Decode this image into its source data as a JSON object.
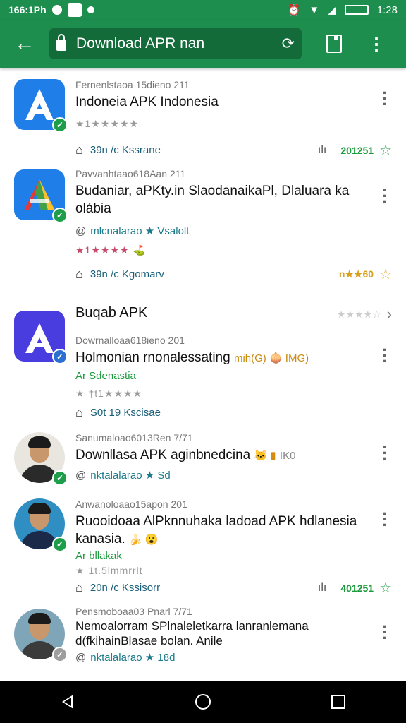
{
  "status_bar": {
    "time_left": "166:1Ph",
    "time_right": "1:28"
  },
  "toolbar": {
    "url": "Download APR nan"
  },
  "items": [
    {
      "meta": "Fernenlstaoa 15dieno 211",
      "title": "Indoneia APK Indonesia",
      "stars": "★1★★★★★",
      "action": "39n /c Kssrane",
      "stat": "201251",
      "check": "green"
    },
    {
      "meta": "Pavvanhtaao618Aan 211",
      "title": "Budaniar, aPKty.in SlaodanaikaPl, Dlaluara ka olábia",
      "sub": "mlcnalarao ★ Vsalolt",
      "stars": "★1★★★★",
      "action": "39n /c Kgomarv",
      "stat": "n★★60"
    },
    {
      "section": "Buqab APK",
      "meta": "Dowrnalloaa618ieno 201",
      "title": "Holmonian rnonalessating",
      "title_tail": "mih(G) 🧅 IMG)",
      "sub": "Ar Sdenastia",
      "stars": "★ †t1★★★★",
      "action": "S0t 19 Kscisae"
    },
    {
      "meta": "Sanumaloao6013Ren 7/71",
      "title": "Downllasa APK aginbnedcina",
      "title_tail": "IK0",
      "sub": "nktalalarao ★  Sd"
    },
    {
      "meta": "Anwanoloaao15apon 201",
      "title": "Ruooidoaa AlPknnuhaka ladoad APK hdlanesia kanasia.",
      "sub": "Ar bllakak",
      "stars": "★ 1t.5lmmrrlt",
      "action": "20n /c Kssisorr",
      "stat": "401251"
    },
    {
      "meta": "Pensmoboaa03 Pnarl 7/71",
      "title": "Nemoalorram SPlnaleletkarra lanranlemana d(fkihainBlasae bolan. Anile",
      "sub": "nktalalarao ★  18d"
    }
  ]
}
